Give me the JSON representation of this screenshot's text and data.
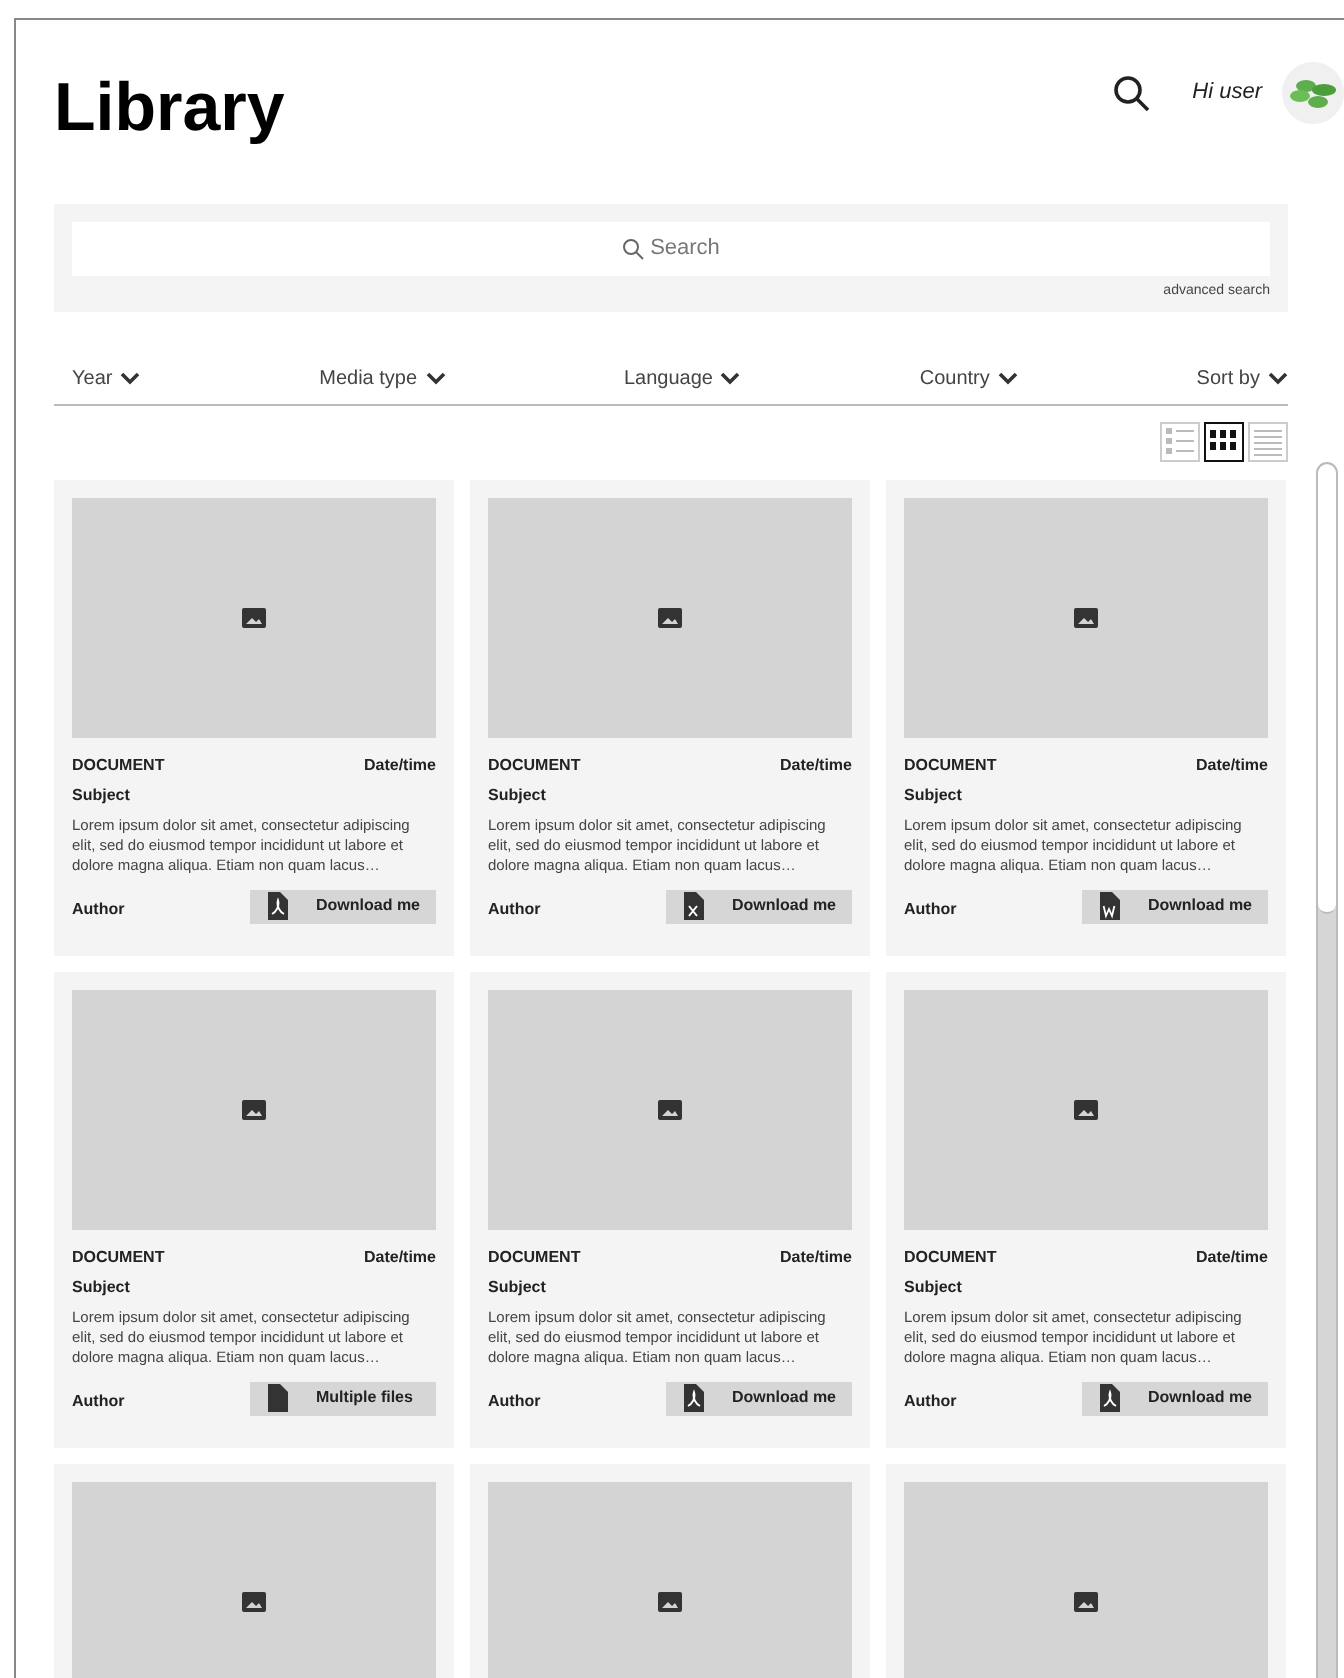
{
  "header": {
    "title": "Library",
    "greeting": "Hi user"
  },
  "search": {
    "placeholder": "Search",
    "advanced_link": "advanced search"
  },
  "filters": [
    {
      "label": "Year"
    },
    {
      "label": "Media type"
    },
    {
      "label": "Language"
    },
    {
      "label": "Country"
    },
    {
      "label": "Sort by"
    }
  ],
  "view_toggle": [
    {
      "kind": "list",
      "selected": false
    },
    {
      "kind": "grid",
      "selected": true
    },
    {
      "kind": "text",
      "selected": false
    }
  ],
  "cards": [
    {
      "kind": "document",
      "type": "DOCUMENT",
      "date": "Date/time",
      "subject": "Subject",
      "excerpt": "Lorem ipsum dolor sit amet, consectetur adipiscing elit, sed do eiusmod tempor incididunt ut labore et dolore magna aliqua. Etiam non quam lacus…",
      "author": "Author",
      "button": {
        "kind": "pdf",
        "label": "Download me"
      }
    },
    {
      "kind": "document",
      "type": "DOCUMENT",
      "date": "Date/time",
      "subject": "Subject",
      "excerpt": "Lorem ipsum dolor sit amet, consectetur adipiscing elit, sed do eiusmod tempor incididunt ut labore et dolore magna aliqua. Etiam non quam lacus…",
      "author": "Author",
      "button": {
        "kind": "excel",
        "label": "Download me"
      }
    },
    {
      "kind": "document",
      "type": "DOCUMENT",
      "date": "Date/time",
      "subject": "Subject",
      "excerpt": "Lorem ipsum dolor sit amet, consectetur adipiscing elit, sed do eiusmod tempor incididunt ut labore et dolore magna aliqua. Etiam non quam lacus…",
      "author": "Author",
      "button": {
        "kind": "word",
        "label": "Download me"
      }
    },
    {
      "kind": "document",
      "type": "DOCUMENT",
      "date": "Date/time",
      "subject": "Subject",
      "excerpt": "Lorem ipsum dolor sit amet, consectetur adipiscing elit, sed do eiusmod tempor incididunt ut labore et dolore magna aliqua. Etiam non quam lacus…",
      "author": "Author",
      "button": {
        "kind": "file",
        "label": "Multiple files"
      }
    },
    {
      "kind": "document",
      "type": "DOCUMENT",
      "date": "Date/time",
      "subject": "Subject",
      "excerpt": "Lorem ipsum dolor sit amet, consectetur adipiscing elit, sed do eiusmod tempor incididunt ut labore et dolore magna aliqua. Etiam non quam lacus…",
      "author": "Author",
      "button": {
        "kind": "pdf",
        "label": "Download me"
      }
    },
    {
      "kind": "document",
      "type": "DOCUMENT",
      "date": "Date/time",
      "subject": "Subject",
      "excerpt": "Lorem ipsum dolor sit amet, consectetur adipiscing elit, sed do eiusmod tempor incididunt ut labore et dolore magna aliqua. Etiam non quam lacus…",
      "author": "Author",
      "button": {
        "kind": "pdf",
        "label": "Download me"
      }
    },
    {
      "kind": "image-only"
    },
    {
      "kind": "image-only"
    },
    {
      "kind": "image-only"
    }
  ]
}
